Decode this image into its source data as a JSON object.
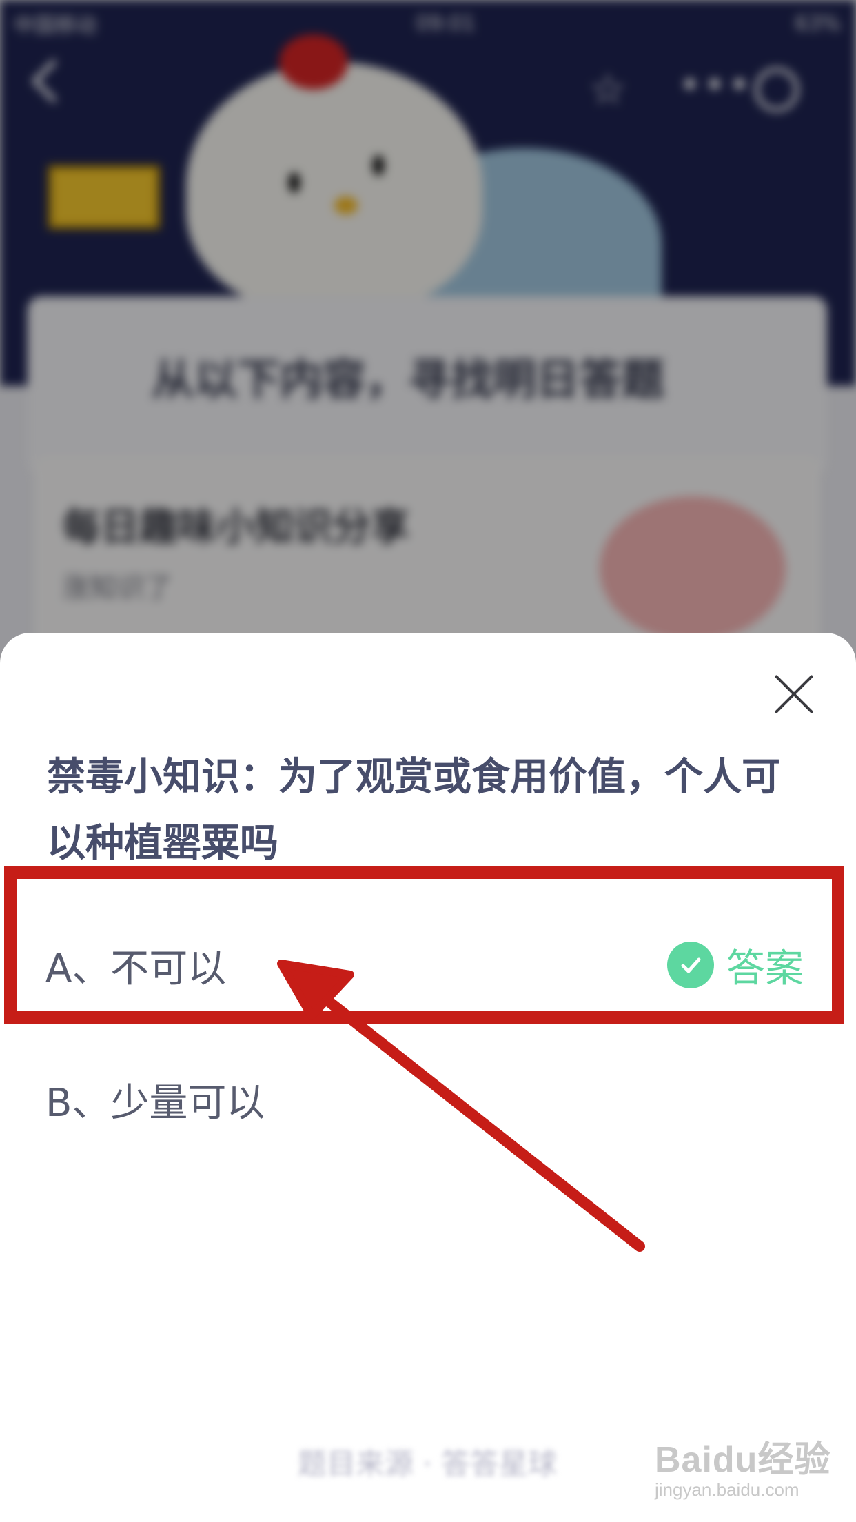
{
  "background": {
    "status_bar": {
      "carrier": "中国移动",
      "time": "09:01",
      "battery": "63%"
    },
    "hero_heading": "从以下内容，寻找明日答题",
    "tip_card": {
      "title": "每日趣味小知识分享",
      "subtitle": "涨知识了"
    }
  },
  "sheet": {
    "question": "禁毒小知识：为了观赏或食用价值，个人可以种植罂粟吗",
    "options": [
      {
        "label": "A、不可以",
        "is_answer": true
      },
      {
        "label": "B、少量可以",
        "is_answer": false
      }
    ],
    "answer_label": "答案",
    "footer": "题目来源 · 答答星球"
  },
  "watermark": {
    "main": "Baidu经验",
    "sub": "jingyan.baidu.com"
  },
  "colors": {
    "answer_green": "#5dd7a0",
    "annotation_red": "#c61d17",
    "question_text": "#474d6b"
  }
}
